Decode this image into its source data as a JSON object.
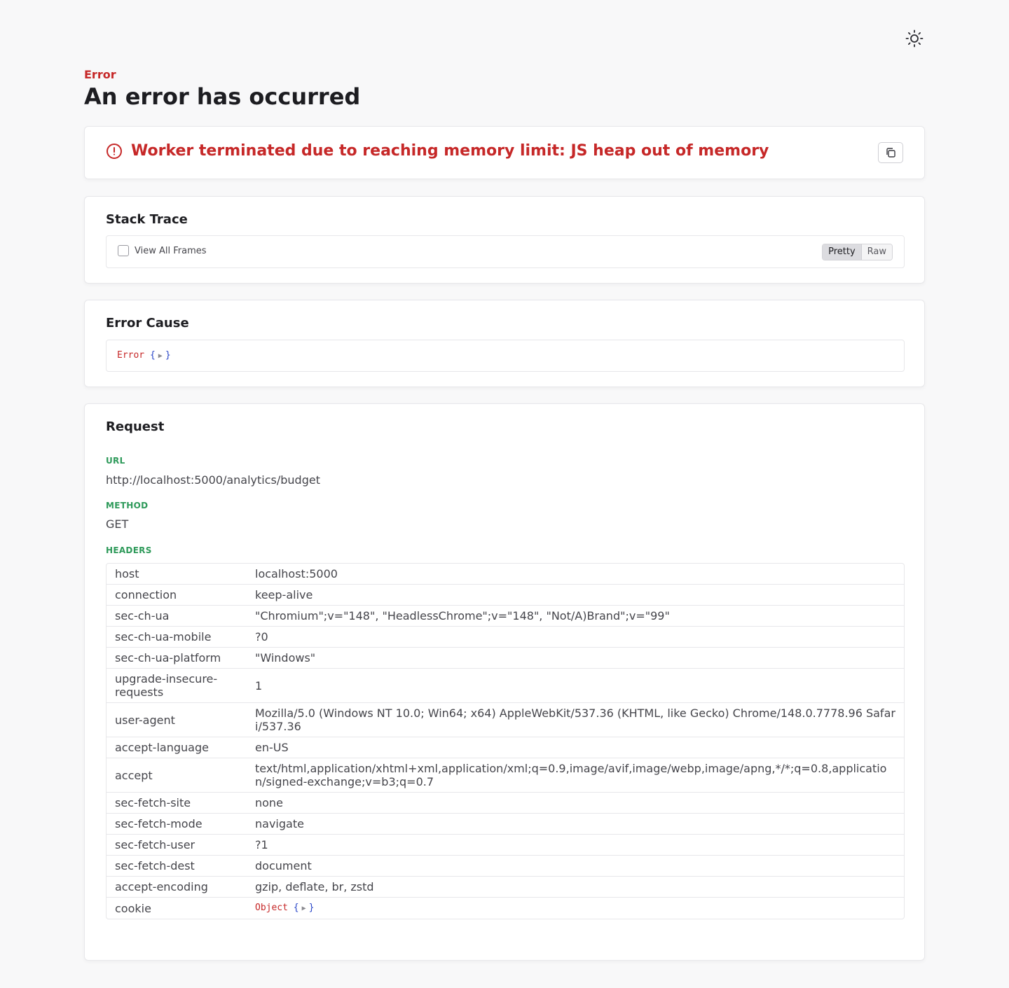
{
  "header": {
    "eyebrow": "Error",
    "title": "An error has occurred"
  },
  "message": {
    "text": "Worker terminated due to reaching memory limit: JS heap out of memory"
  },
  "stack": {
    "title": "Stack Trace",
    "checkbox_label": "View All Frames",
    "modes": [
      "Pretty",
      "Raw"
    ],
    "active_mode": "Pretty"
  },
  "cause": {
    "title": "Error Cause",
    "object_name": "Error",
    "open_brace": "{",
    "close_brace": "}"
  },
  "request": {
    "title": "Request",
    "url_label": "URL",
    "url": "http://localhost:5000/analytics/budget",
    "method_label": "METHOD",
    "method": "GET",
    "headers_label": "HEADERS",
    "headers": [
      {
        "key": "host",
        "value": "localhost:5000"
      },
      {
        "key": "connection",
        "value": "keep-alive"
      },
      {
        "key": "sec-ch-ua",
        "value": "\"Chromium\";v=\"148\", \"HeadlessChrome\";v=\"148\", \"Not/A)Brand\";v=\"99\""
      },
      {
        "key": "sec-ch-ua-mobile",
        "value": "?0"
      },
      {
        "key": "sec-ch-ua-platform",
        "value": "\"Windows\""
      },
      {
        "key": "upgrade-insecure-requests",
        "value": "1"
      },
      {
        "key": "user-agent",
        "value": "Mozilla/5.0 (Windows NT 10.0; Win64; x64) AppleWebKit/537.36 (KHTML, like Gecko) Chrome/148.0.7778.96 Safari/537.36"
      },
      {
        "key": "accept-language",
        "value": "en-US"
      },
      {
        "key": "accept",
        "value": "text/html,application/xhtml+xml,application/xml;q=0.9,image/avif,image/webp,image/apng,*/*;q=0.8,application/signed-exchange;v=b3;q=0.7"
      },
      {
        "key": "sec-fetch-site",
        "value": "none"
      },
      {
        "key": "sec-fetch-mode",
        "value": "navigate"
      },
      {
        "key": "sec-fetch-user",
        "value": "?1"
      },
      {
        "key": "sec-fetch-dest",
        "value": "document"
      },
      {
        "key": "accept-encoding",
        "value": "gzip, deflate, br, zstd"
      },
      {
        "key": "cookie",
        "value": ""
      }
    ],
    "cookie_object_name": "Object",
    "open_brace": "{",
    "close_brace": "}"
  },
  "icons": {
    "theme": "sun-icon",
    "message": "alert-circle-icon",
    "copy": "copy-icon",
    "expand": "triangle-right-icon"
  },
  "colors": {
    "error_red": "#c62828",
    "label_green": "#2e9a5a",
    "brace_blue": "#2845c8"
  }
}
